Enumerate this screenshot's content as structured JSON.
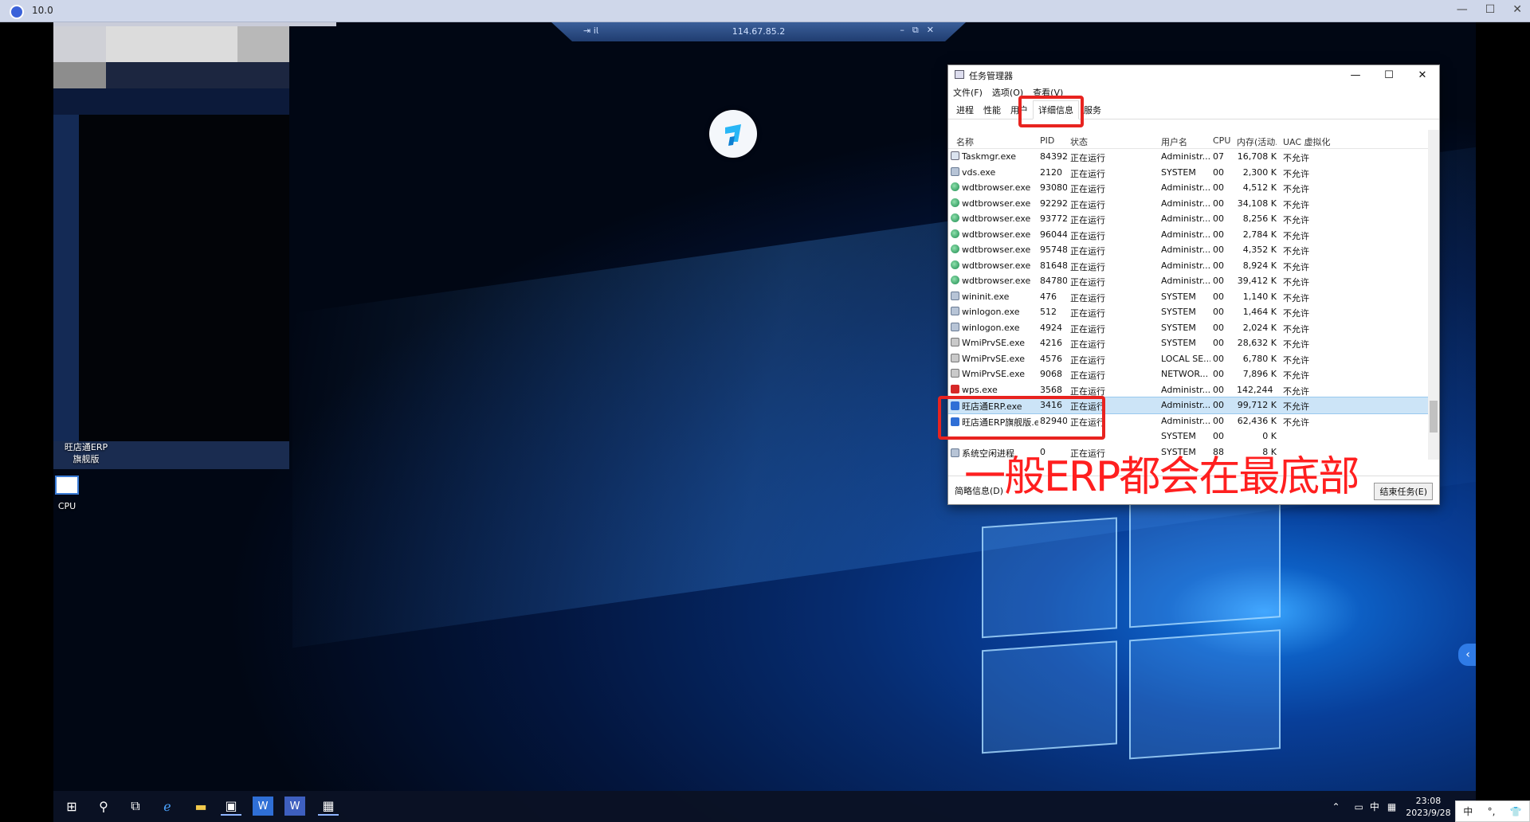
{
  "outer": {
    "ip_text": "10.0",
    "controls": [
      "—",
      "☐",
      "✕"
    ]
  },
  "rdp": {
    "ip": "114.67.85.2",
    "left": "⇥ 𝗂𝗅",
    "right": [
      "–",
      "⧉",
      "✕"
    ]
  },
  "desktop": {
    "icons": [
      {
        "label": "旺店通ERP旗舰版"
      },
      {
        "label": "CPU"
      }
    ]
  },
  "task_manager": {
    "title": "任务管理器",
    "controls": [
      "—",
      "☐",
      "✕"
    ],
    "menu": [
      "文件(F)",
      "选项(O)",
      "查看(V)"
    ],
    "tabs": [
      "进程",
      "性能",
      "用户",
      "详细信息",
      "服务"
    ],
    "columns": [
      "名称",
      "PID",
      "状态",
      "用户名",
      "CPU",
      "内存(活动...",
      "UAC 虚拟化"
    ],
    "rows": [
      [
        "Taskmgr.exe",
        "84392",
        "正在运行",
        "Administr...",
        "07",
        "16,708 K",
        "不允许"
      ],
      [
        "vds.exe",
        "2120",
        "正在运行",
        "SYSTEM",
        "00",
        "2,300 K",
        "不允许"
      ],
      [
        "wdtbrowser.exe",
        "93080",
        "正在运行",
        "Administr...",
        "00",
        "4,512 K",
        "不允许"
      ],
      [
        "wdtbrowser.exe",
        "92292",
        "正在运行",
        "Administr...",
        "00",
        "34,108 K",
        "不允许"
      ],
      [
        "wdtbrowser.exe",
        "93772",
        "正在运行",
        "Administr...",
        "00",
        "8,256 K",
        "不允许"
      ],
      [
        "wdtbrowser.exe",
        "96044",
        "正在运行",
        "Administr...",
        "00",
        "2,784 K",
        "不允许"
      ],
      [
        "wdtbrowser.exe",
        "95748",
        "正在运行",
        "Administr...",
        "00",
        "4,352 K",
        "不允许"
      ],
      [
        "wdtbrowser.exe",
        "81648",
        "正在运行",
        "Administr...",
        "00",
        "8,924 K",
        "不允许"
      ],
      [
        "wdtbrowser.exe",
        "84780",
        "正在运行",
        "Administr...",
        "00",
        "39,412 K",
        "不允许"
      ],
      [
        "wininit.exe",
        "476",
        "正在运行",
        "SYSTEM",
        "00",
        "1,140 K",
        "不允许"
      ],
      [
        "winlogon.exe",
        "512",
        "正在运行",
        "SYSTEM",
        "00",
        "1,464 K",
        "不允许"
      ],
      [
        "winlogon.exe",
        "4924",
        "正在运行",
        "SYSTEM",
        "00",
        "2,024 K",
        "不允许"
      ],
      [
        "WmiPrvSE.exe",
        "4216",
        "正在运行",
        "SYSTEM",
        "00",
        "28,632 K",
        "不允许"
      ],
      [
        "WmiPrvSE.exe",
        "4576",
        "正在运行",
        "LOCAL SE...",
        "00",
        "6,780 K",
        "不允许"
      ],
      [
        "WmiPrvSE.exe",
        "9068",
        "正在运行",
        "NETWOR...",
        "00",
        "7,896 K",
        "不允许"
      ],
      [
        "wps.exe",
        "3568",
        "正在运行",
        "Administr...",
        "00",
        "142,244 K",
        "不允许"
      ],
      [
        "旺店通ERP.exe",
        "3416",
        "正在运行",
        "Administr...",
        "00",
        "99,712 K",
        "不允许"
      ],
      [
        "旺店通ERP旗舰版.exe",
        "82940",
        "正在运行",
        "Administr...",
        "00",
        "62,436 K",
        "不允许"
      ],
      [
        "",
        "",
        "",
        "SYSTEM",
        "00",
        "0 K",
        ""
      ],
      [
        "系统空闲进程",
        "0",
        "正在运行",
        "SYSTEM",
        "88",
        "8 K",
        ""
      ]
    ],
    "icon_types": [
      "tm",
      "sys",
      "browser",
      "browser",
      "browser",
      "browser",
      "browser",
      "browser",
      "browser",
      "sys",
      "sys",
      "sys",
      "wmi",
      "wmi",
      "wmi",
      "wps",
      "erp",
      "erp",
      "",
      "sys"
    ],
    "selected_row": 16,
    "fewer_details": "简略信息(D)",
    "end_task": "结束任务(E)"
  },
  "annotation": "一般ERP都会在最底部",
  "taskbar": {
    "icons": [
      "start-icon",
      "search-icon",
      "task-view-icon",
      "ie-icon",
      "file-explorer-icon",
      "remote-desktop-icon",
      "erp-icon",
      "erp-flagship-icon",
      "calculator-icon"
    ],
    "tray": {
      "ime": "中",
      "time": "23:08",
      "date": "2023/9/28"
    }
  },
  "outer_tray": [
    "中",
    "°,",
    "👕"
  ]
}
